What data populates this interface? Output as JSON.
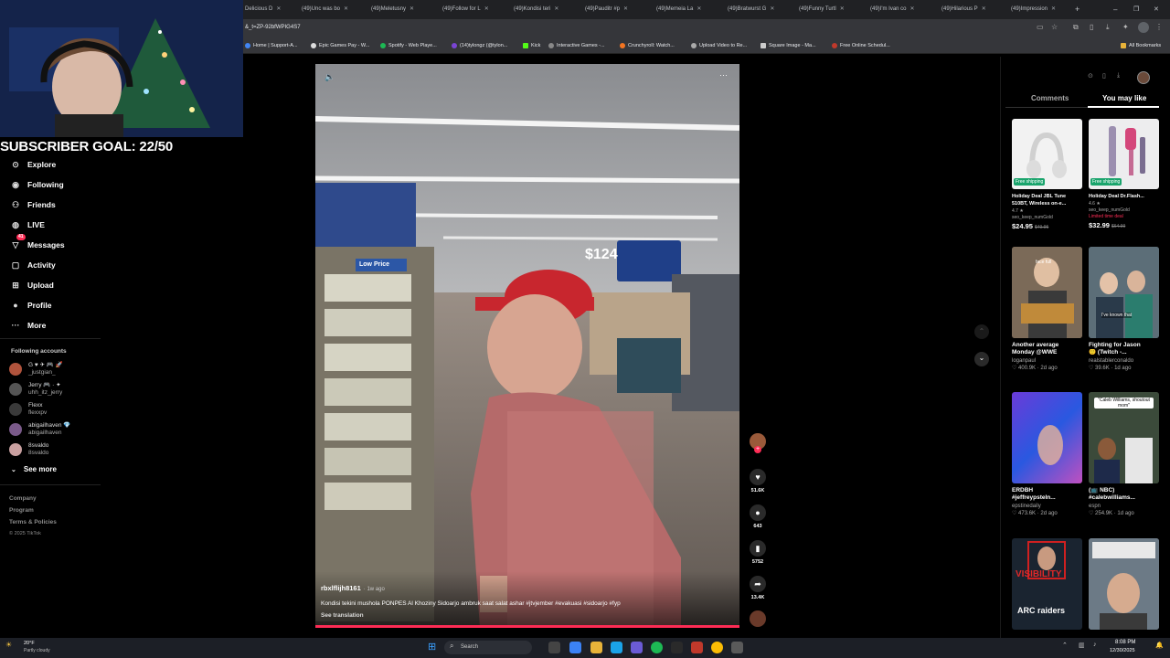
{
  "browser": {
    "tabs": [
      "Delicious D",
      "(49)Unc was bo",
      "(49)Meletusny",
      "(49)Follow for L",
      "(49)Kondisi teri",
      "(49)Pauditr #p",
      "(49)Memeia La",
      "(49)Bratwurst G",
      "(49)Funny Turtl",
      "(49)I'm Ivan co",
      "(49)Hilarious P",
      "(49)Impression"
    ],
    "url": "&_t=ZP-92bfWPIG4S7",
    "bookmarks": [
      "Home | Support-A...",
      "Epic Games Pay - W...",
      "Spotify - Web Playe...",
      "(14)tylongz (@tylon...",
      "Kick",
      "Interactive Games -...",
      "Crunchyroll: Watch...",
      "Upload Video to Re...",
      "Square Image - Ma...",
      "Free Online Schedul..."
    ],
    "all_bookmarks": "All Bookmarks"
  },
  "overlay": {
    "subscriber_goal": "SUBSCRIBER GOAL: 22/50"
  },
  "sidebar": {
    "nav": [
      {
        "label": "Explore",
        "icon": "compass-icon"
      },
      {
        "label": "Following",
        "icon": "following-icon"
      },
      {
        "label": "Friends",
        "icon": "friends-icon"
      },
      {
        "label": "LIVE",
        "icon": "live-icon"
      },
      {
        "label": "Messages",
        "icon": "messages-icon"
      },
      {
        "label": "Activity",
        "icon": "activity-icon"
      },
      {
        "label": "Upload",
        "icon": "upload-icon"
      },
      {
        "label": "Profile",
        "icon": "profile-icon"
      },
      {
        "label": "More",
        "icon": "more-icon"
      }
    ],
    "messages_badge": "41",
    "following_header": "Following accounts",
    "accounts": [
      {
        "name": "G ♥ ✈ 🎮 🚀",
        "handle": "_justgian_"
      },
      {
        "name": "Jerry 🎮 · ✦",
        "handle": "uhh_itz_jerry"
      },
      {
        "name": "Flexx",
        "handle": "flexxpv"
      },
      {
        "name": "abigailhaven 💎",
        "handle": "abigailhaven"
      },
      {
        "name": "8svaldo",
        "handle": "8svaldo"
      }
    ],
    "see_more": "See more",
    "footer": [
      "Company",
      "Program",
      "Terms & Policies"
    ],
    "copyright": "© 2025 TikTok"
  },
  "video": {
    "author": "rbxlflijh8161",
    "time": "· 1w ago",
    "caption": "Kondisi tekini mushola PONPES Al Khoziny Sidoarjo ambruk saat salat ashar #jtvjember #evakuasi #sidoarjo #fyp",
    "see_translation": "See translation",
    "sign_price": "$124",
    "low_price": "Low Price"
  },
  "actions": {
    "likes": "51.6K",
    "comments": "643",
    "saves": "5752",
    "shares": "13.4K"
  },
  "panel": {
    "tabs": [
      "Comments",
      "You may like"
    ],
    "items": [
      {
        "badge": "Free shipping",
        "title": "Holiday Deal JBL Tune 510BT, Wireless on-e...",
        "rating": "4.7 ★",
        "seller": "seo_keep_numGold",
        "price": "$24.95",
        "old": "$49.95"
      },
      {
        "badge": "Free shipping",
        "title": "Holiday Deal Dr.Flash...",
        "rating": "4.6 ★",
        "seller": "seo_keep_numGold",
        "limited": "Limited time deal",
        "price": "$32.99",
        "old": "$64.99"
      },
      {
        "overlay": "face full",
        "title": "Another average",
        "title2": "Monday @WWE",
        "author": "loganpaul",
        "likes": "♡ 400.9K",
        "age": "· 2d ago"
      },
      {
        "overlay": "I've known that",
        "title": "Fighting for Jason",
        "title2": "🙂 (Twitch -...",
        "author": "realstablerconaldo",
        "likes": "♡ 39.6K",
        "age": "· 1d ago"
      },
      {
        "title": "ERDBH",
        "title2": "#jeffreypsteln...",
        "author": "epstinedaily",
        "likes": "♡ 473.6K",
        "age": "· 2d ago"
      },
      {
        "overlay": "\"Caleb Williams, shoutout mom\"",
        "title": "(📺 NBC)",
        "title2": "#calebwilliams...",
        "author": "espn",
        "likes": "♡ 254.9K",
        "age": "· 1d ago"
      },
      {
        "overlay": "VISIBILITY",
        "sub": "ARC raiders"
      },
      {}
    ]
  },
  "taskbar": {
    "weather_temp": "20°F",
    "weather_desc": "Partly cloudy",
    "search": "Search",
    "time": "8:08 PM",
    "date": "12/30/2025"
  }
}
